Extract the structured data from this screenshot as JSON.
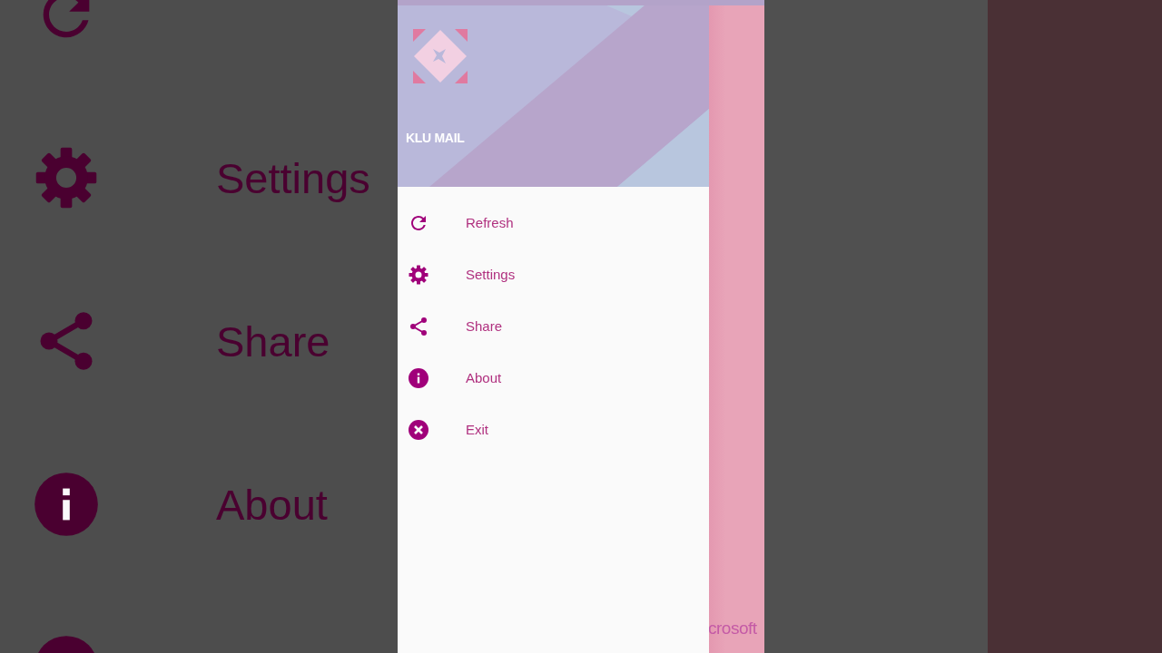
{
  "backdrop": {
    "items": [
      {
        "kind": "refresh"
      },
      {
        "kind": "settings",
        "label": "Settings"
      },
      {
        "kind": "share",
        "label": "Share"
      },
      {
        "kind": "about",
        "label": "About"
      },
      {
        "kind": "exit"
      }
    ]
  },
  "drawer": {
    "header": {
      "title": "KLU MAIL"
    },
    "items": [
      {
        "kind": "refresh",
        "label": "Refresh"
      },
      {
        "kind": "settings",
        "label": "Settings"
      },
      {
        "kind": "share",
        "label": "Share"
      },
      {
        "kind": "about",
        "label": "About"
      },
      {
        "kind": "exit",
        "label": "Exit"
      }
    ]
  },
  "behind": {
    "text": "crosoft"
  }
}
